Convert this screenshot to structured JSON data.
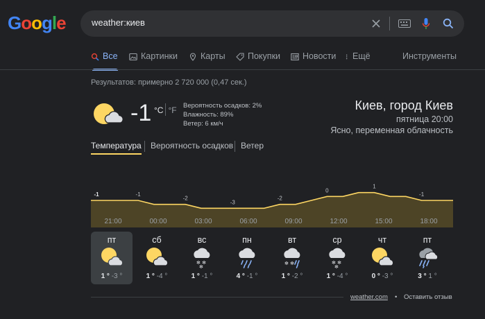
{
  "logo": {
    "text": "Google"
  },
  "search": {
    "query": "weather:киев"
  },
  "tabs": [
    {
      "label": "Все",
      "icon": "search-icon",
      "active": true
    },
    {
      "label": "Картинки",
      "icon": "image-icon"
    },
    {
      "label": "Карты",
      "icon": "map-pin-icon"
    },
    {
      "label": "Покупки",
      "icon": "tag-icon"
    },
    {
      "label": "Новости",
      "icon": "news-icon"
    },
    {
      "label": "Ещё",
      "icon": "more-vert-icon"
    }
  ],
  "tools_label": "Инструменты",
  "result_stats": "Результатов: примерно 2 720 000 (0,47 сек.)",
  "weather": {
    "current_temp": "-1",
    "unit_c": "°C",
    "unit_f": "°F",
    "precip": "Вероятность осадков: 2%",
    "humidity": "Влажность: 89%",
    "wind": "Ветер: 6 км/ч",
    "location": "Киев, город Киев",
    "time": "пятница 20:00",
    "condition": "Ясно, переменная облачность",
    "subtabs": [
      "Температура",
      "Вероятность осадков",
      "Ветер"
    ],
    "hours": [
      "21:00",
      "00:00",
      "03:00",
      "06:00",
      "09:00",
      "12:00",
      "15:00",
      "18:00"
    ],
    "forecast": [
      {
        "day": "пт",
        "icon": "partly-cloudy-icon",
        "high": "1 °",
        "low": "-3 °",
        "selected": true
      },
      {
        "day": "сб",
        "icon": "partly-cloudy-icon",
        "high": "1 °",
        "low": "-4 °"
      },
      {
        "day": "вс",
        "icon": "snow-icon",
        "high": "1 °",
        "low": "-1 °"
      },
      {
        "day": "пн",
        "icon": "rain-icon",
        "high": "4 °",
        "low": "-1 °"
      },
      {
        "day": "вт",
        "icon": "snow-rain-icon",
        "high": "1 °",
        "low": "-2 °"
      },
      {
        "day": "ср",
        "icon": "snow-icon",
        "high": "1 °",
        "low": "-4 °"
      },
      {
        "day": "чт",
        "icon": "partly-cloudy-icon",
        "high": "0 °",
        "low": "-3 °"
      },
      {
        "day": "пт",
        "icon": "showers-icon",
        "high": "3 °",
        "low": "1 °"
      }
    ],
    "source": "weather.com",
    "feedback": "Оставить отзыв"
  },
  "chart_data": {
    "type": "area",
    "x": [
      "21:00",
      "22:00",
      "23:00",
      "00:00",
      "01:00",
      "02:00",
      "03:00",
      "04:00",
      "05:00",
      "06:00",
      "07:00",
      "08:00",
      "09:00",
      "10:00",
      "11:00",
      "12:00",
      "13:00",
      "14:00",
      "15:00",
      "16:00",
      "17:00",
      "18:00",
      "19:00",
      "20:00"
    ],
    "values": [
      -1,
      -1,
      -1,
      -1,
      -2,
      -2,
      -2,
      -3,
      -3,
      -3,
      -3,
      -3,
      -2,
      -2,
      -1,
      0,
      0,
      1,
      1,
      0,
      0,
      -1,
      -1,
      -1
    ],
    "labels": [
      {
        "index": 0,
        "text": "-1"
      },
      {
        "index": 3,
        "text": "-1"
      },
      {
        "index": 6,
        "text": "-2"
      },
      {
        "index": 9,
        "text": "-3"
      },
      {
        "index": 12,
        "text": "-2"
      },
      {
        "index": 15,
        "text": "0"
      },
      {
        "index": 18,
        "text": "1"
      },
      {
        "index": 21,
        "text": "-1"
      }
    ],
    "line_color": "#fdd663",
    "fill_color": "#4d4426"
  },
  "colors": {
    "accent": "#8ab4f8",
    "sun": "#fdd663"
  }
}
